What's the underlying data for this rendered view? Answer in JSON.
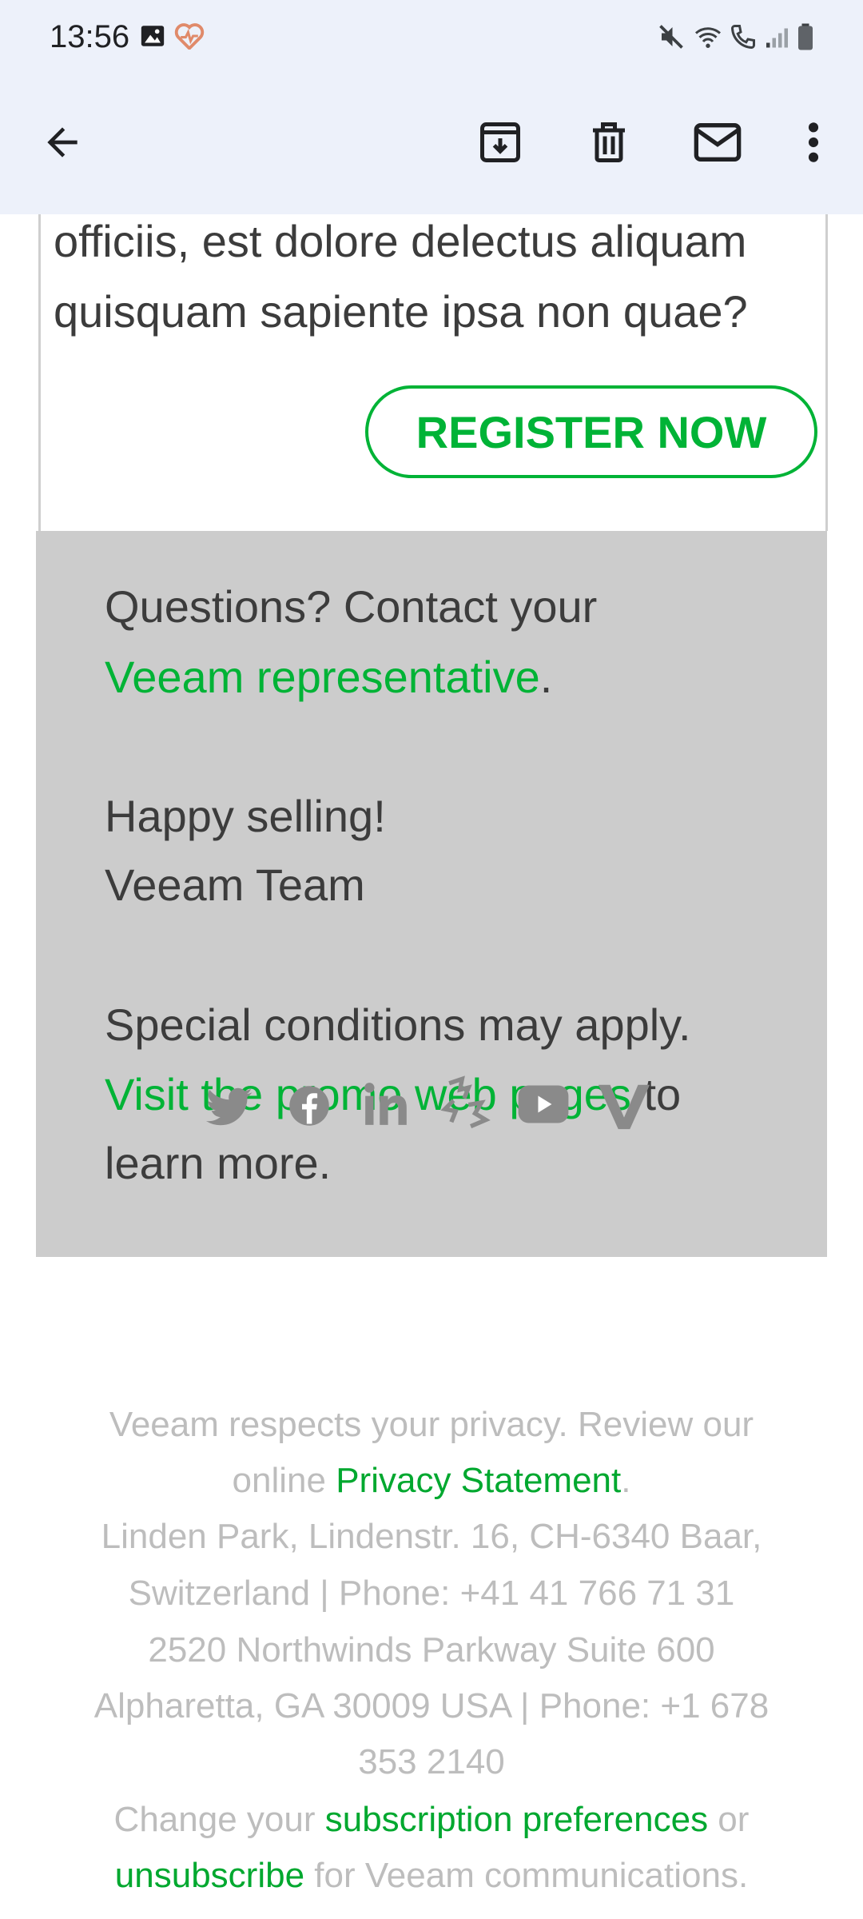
{
  "status_bar": {
    "time": "13:56"
  },
  "email": {
    "body_text_line1": "officiis, est dolore delectus aliquam",
    "body_text_line2": "quisquam sapiente ipsa non quae?",
    "register_label": "REGISTER NOW",
    "questions_text": "Questions? Contact your",
    "rep_link": "Veeam representative",
    "rep_period": ".",
    "greeting": "Happy selling!",
    "signature": "Veeam Team",
    "conditions_text": "Special conditions may apply.",
    "promo_link": "Visit the promo web pages",
    "promo_suffix": " to",
    "promo_line3": "learn more."
  },
  "footer": {
    "privacy_line1": "Veeam respects your privacy. Review our",
    "privacy_prefix": "online ",
    "privacy_link": "Privacy Statement",
    "privacy_period": ".",
    "address1_line1": "Linden Park, Lindenstr. 16, CH-6340 Baar,",
    "address1_line2": "Switzerland | Phone: +41 41 766 71 31",
    "address2_line1": "2520 Northwinds Parkway Suite 600",
    "address2_line2": "Alpharetta, GA 30009 USA | Phone: +1 678",
    "address2_line3": "353 2140",
    "subscription_prefix": "Change your ",
    "subscription_link": "subscription preferences",
    "subscription_suffix": " or",
    "unsubscribe_link": "unsubscribe",
    "unsubscribe_suffix": " for Veeam communications."
  },
  "colors": {
    "accent_green": "#00b336",
    "grey_panel": "#cccccc",
    "topbar_bg": "#edf1fa"
  }
}
